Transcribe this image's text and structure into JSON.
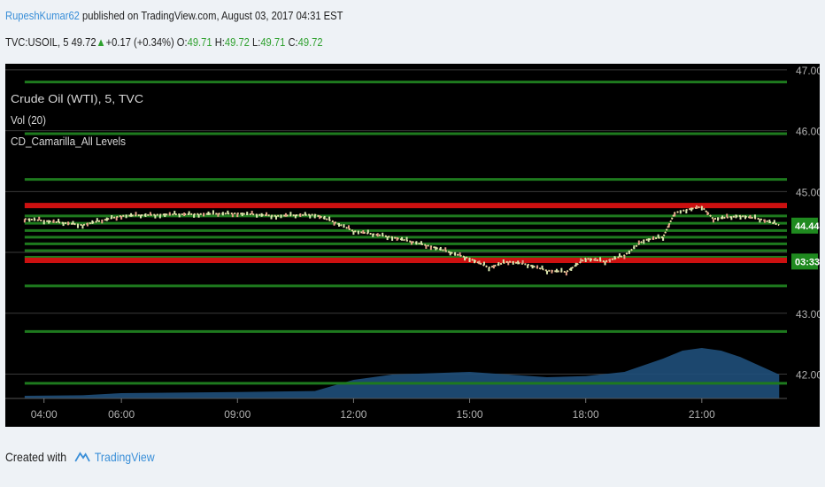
{
  "header": {
    "author": "RupeshKumar62",
    "published": " published on TradingView.com, August 03, 2017 04:31 EST"
  },
  "quote": {
    "symbol": "TVC:USOIL, 5",
    "last": "49.72",
    "arrow": "▲",
    "change": "+0.17 (+0.34%)",
    "o_label": " O:",
    "o": "49.71",
    "h_label": " H:",
    "h": "49.72",
    "l_label": " L:",
    "l": "49.71",
    "c_label": " C:",
    "c": "49.72"
  },
  "footer": {
    "created_with": "Created with",
    "brand": "TradingView",
    "logo_icon": "tradingview-logo-icon"
  },
  "colors": {
    "background": "#000000",
    "gridline": "#3a3a3a",
    "camarilla_green": "#1e7a1e",
    "camarilla_red": "#cc1010",
    "candle": "#e8d8a0",
    "volume": "#1f4f7a",
    "price_label_green": "#1f8a1f",
    "axis_text": "#b0b0b0"
  },
  "chart_data": {
    "type": "candlestick",
    "legend": [
      "Crude Oil (WTI), 5, TVC",
      "Vol (20)",
      "CD_Camarilla_All Levels"
    ],
    "x_ticks": [
      "04:00",
      "06:00",
      "09:00",
      "12:00",
      "15:00",
      "18:00",
      "21:00"
    ],
    "x_tick_hours": [
      4,
      6,
      9,
      12,
      15,
      18,
      21
    ],
    "xlim": [
      3,
      23.2
    ],
    "y_ticks": [
      "47.00",
      "46.00",
      "45.00",
      "43.00",
      "42.00"
    ],
    "y_tick_values": [
      47,
      46,
      45,
      43,
      42
    ],
    "ylim": [
      41.6,
      47.1
    ],
    "price_labels": [
      {
        "text": "44.44",
        "value": 44.44
      },
      {
        "text": "03:33",
        "value": 43.85
      }
    ],
    "camarilla_levels": {
      "green": [
        46.8,
        45.95,
        45.2,
        44.6,
        44.48,
        44.36,
        44.25,
        44.14,
        44.03,
        43.92,
        43.45,
        42.7,
        41.85
      ],
      "red": [
        44.77,
        43.87
      ],
      "start_hour": 3.5
    },
    "price_series": {
      "hours": [
        3.5,
        4.0,
        5.0,
        6.0,
        7.0,
        8.0,
        9.0,
        10.0,
        11.0,
        11.5,
        12.0,
        13.0,
        14.0,
        15.0,
        15.5,
        16.0,
        16.5,
        17.0,
        17.5,
        18.0,
        18.5,
        19.0,
        19.5,
        20.0,
        20.3,
        20.6,
        21.0,
        21.3,
        22.0,
        22.5,
        23.0
      ],
      "prices": [
        44.55,
        44.52,
        44.45,
        44.6,
        44.62,
        44.63,
        44.64,
        44.6,
        44.62,
        44.5,
        44.35,
        44.25,
        44.1,
        43.9,
        43.75,
        43.85,
        43.8,
        43.7,
        43.68,
        43.9,
        43.85,
        43.95,
        44.2,
        44.25,
        44.65,
        44.7,
        44.75,
        44.55,
        44.6,
        44.55,
        44.45
      ]
    },
    "volume_series": {
      "hours": [
        3.5,
        5.0,
        6.0,
        9.0,
        11.0,
        12.0,
        13.0,
        15.0,
        16.0,
        17.0,
        18.0,
        19.0,
        20.0,
        20.5,
        21.0,
        21.5,
        22.0,
        23.0
      ],
      "values": [
        0.05,
        0.06,
        0.1,
        0.12,
        0.14,
        0.35,
        0.45,
        0.5,
        0.45,
        0.4,
        0.42,
        0.5,
        0.75,
        0.9,
        0.95,
        0.9,
        0.78,
        0.45
      ]
    }
  }
}
